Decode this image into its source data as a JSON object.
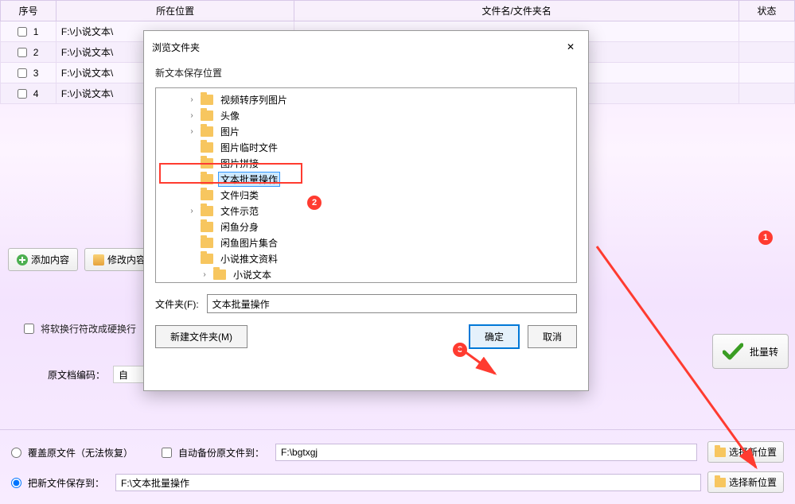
{
  "table": {
    "headers": {
      "seq": "序号",
      "loc": "所在位置",
      "name": "文件名/文件夹名",
      "state": "状态"
    },
    "rows": [
      {
        "seq": "1",
        "loc": "F:\\小说文本\\"
      },
      {
        "seq": "2",
        "loc": "F:\\小说文本\\"
      },
      {
        "seq": "3",
        "loc": "F:\\小说文本\\"
      },
      {
        "seq": "4",
        "loc": "F:\\小说文本\\"
      }
    ]
  },
  "toolbar": {
    "add": "添加内容",
    "edit": "修改内容"
  },
  "opts": {
    "softwrap": "将软换行符改成硬换行",
    "enc_label": "原文档编码：",
    "enc_value": "自"
  },
  "bottom": {
    "overwrite": "覆盖原文件（无法恢复）",
    "autobak": "自动备份原文件到：",
    "bak_path": "F:\\bgtxgj",
    "saveas": "把新文件保存到：",
    "save_path": "F:\\文本批量操作",
    "choose": "选择新位置"
  },
  "bigbtn": {
    "label": "批量转"
  },
  "dialog": {
    "title": "浏览文件夹",
    "subtitle": "新文本保存位置",
    "tree": [
      {
        "label": "视频转序列图片",
        "expand": true
      },
      {
        "label": "头像",
        "expand": true
      },
      {
        "label": "图片",
        "expand": true
      },
      {
        "label": "图片临时文件",
        "expand": false
      },
      {
        "label": "图片拼接",
        "expand": false
      },
      {
        "label": "文本批量操作",
        "expand": false,
        "selected": true
      },
      {
        "label": "文件归类",
        "expand": false
      },
      {
        "label": "文件示范",
        "expand": true
      },
      {
        "label": "闲鱼分身",
        "expand": false
      },
      {
        "label": "闲鱼图片集合",
        "expand": false
      },
      {
        "label": "小说推文资料",
        "expand": false
      },
      {
        "label": "小说文本",
        "expand": true,
        "deep": true
      }
    ],
    "folder_label": "文件夹(F):",
    "folder_value": "文本批量操作",
    "new_folder": "新建文件夹(M)",
    "ok": "确定",
    "cancel": "取消"
  },
  "badges": {
    "b1": "1",
    "b2": "2",
    "b3": "3"
  }
}
